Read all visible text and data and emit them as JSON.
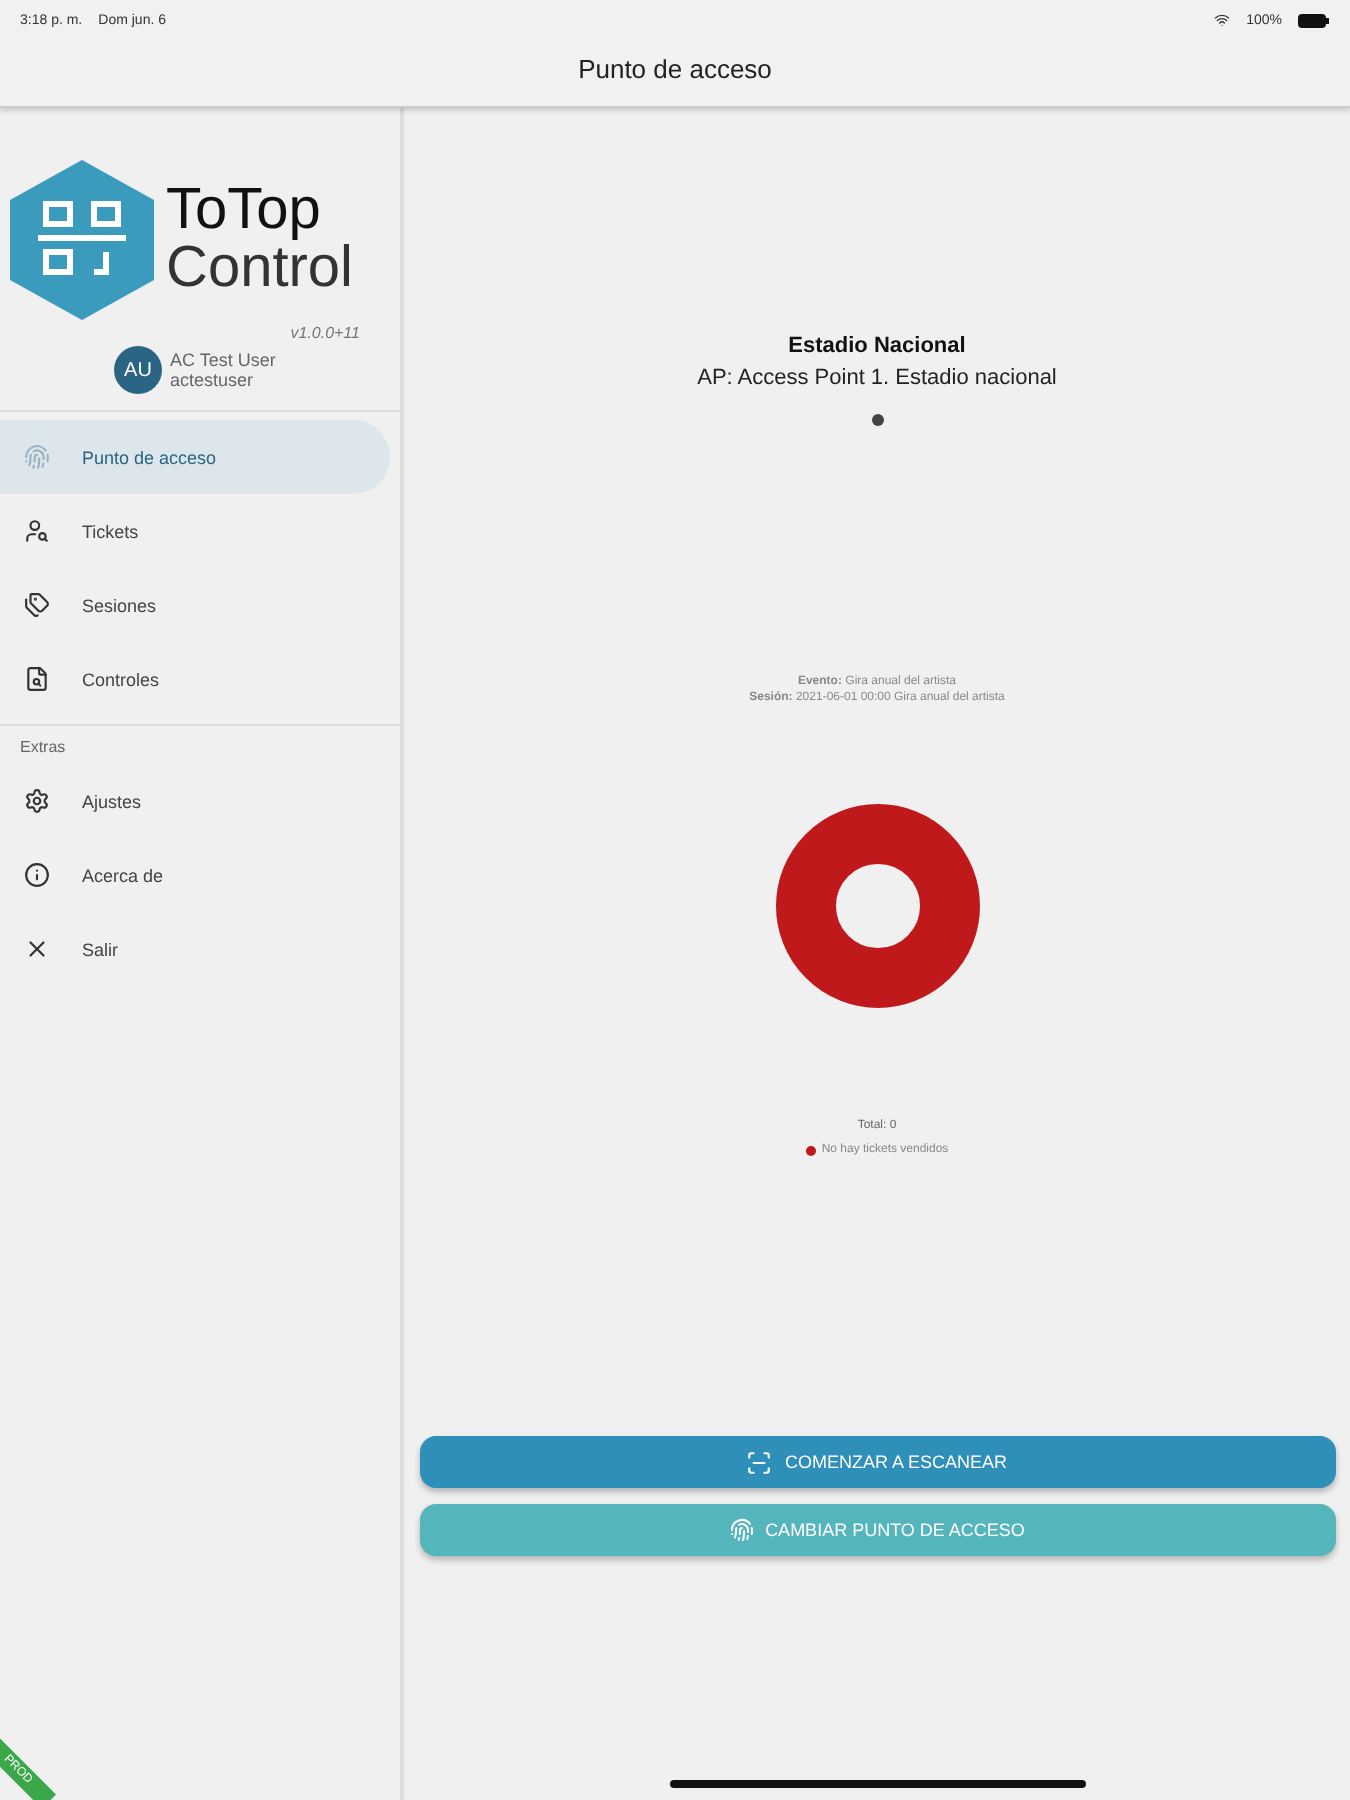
{
  "status_bar": {
    "time": "3:18 p. m.",
    "date": "Dom jun. 6",
    "battery": "100%"
  },
  "header": {
    "title": "Punto de acceso"
  },
  "sidebar": {
    "logo": {
      "line1": "ToTop",
      "line2": "Control"
    },
    "version": "v1.0.0+11",
    "user": {
      "initials": "AU",
      "name": "AC Test User",
      "username": "actestuser"
    },
    "items": [
      {
        "label": "Punto de acceso",
        "kind": "fingerprint",
        "selected": true
      },
      {
        "label": "Tickets",
        "kind": "search",
        "selected": false
      },
      {
        "label": "Sesiones",
        "kind": "tags",
        "selected": false
      },
      {
        "label": "Controles",
        "kind": "document",
        "selected": false
      }
    ],
    "section": "Extras",
    "extras": [
      {
        "label": "Ajustes",
        "kind": "gear",
        "selected": false
      },
      {
        "label": "Acerca de",
        "kind": "info",
        "selected": false
      },
      {
        "label": "Salir",
        "kind": "close",
        "selected": false
      }
    ]
  },
  "main": {
    "venue": "Estadio Nacional",
    "access_point": "AP: Access Point 1. Estadio nacional",
    "event_label": "Evento:",
    "event": "Gira anual del artista",
    "session_label": "Sesión:",
    "session": "2021-06-01 00:00 Gira anual del artista",
    "total": "Total: 0",
    "legend": [
      {
        "label": "No hay tickets vendidos",
        "color": "#c0191c"
      }
    ],
    "buttons": [
      {
        "label": "COMENZAR A ESCANEAR",
        "kind": "scan"
      },
      {
        "label": "CAMBIAR PUNTO DE ACCESO",
        "kind": "change"
      }
    ]
  },
  "ribbon": "PROD"
}
